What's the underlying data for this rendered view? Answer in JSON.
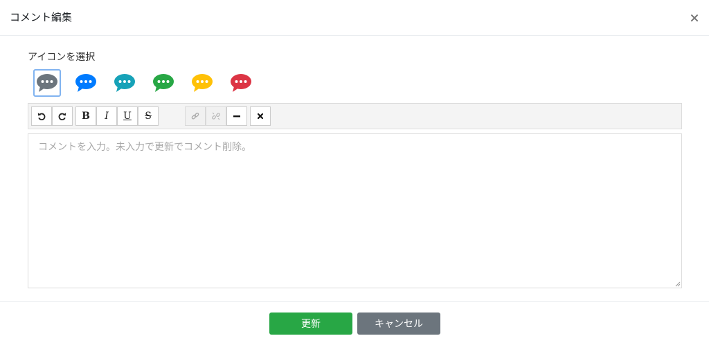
{
  "dialog": {
    "title": "コメント編集",
    "close_icon": "close-icon"
  },
  "icon_picker": {
    "label": "アイコンを選択",
    "selected_index": 0,
    "options": [
      {
        "name": "gray",
        "color": "#6c757d"
      },
      {
        "name": "blue",
        "color": "#007bff"
      },
      {
        "name": "teal",
        "color": "#17a2b8"
      },
      {
        "name": "green",
        "color": "#28a745"
      },
      {
        "name": "yellow",
        "color": "#ffc107"
      },
      {
        "name": "red",
        "color": "#dc3545"
      }
    ]
  },
  "toolbar": {
    "undo_icon": "undo-icon",
    "redo_icon": "redo-icon",
    "bold_label": "B",
    "italic_label": "I",
    "underline_label": "U",
    "strike_label": "S",
    "link_icon": "link-icon",
    "unlink_icon": "unlink-icon",
    "hr_icon": "horizontal-rule-icon",
    "clear_icon": "clear-format-icon"
  },
  "editor": {
    "value": "",
    "placeholder": "コメントを入力。未入力で更新でコメント削除。"
  },
  "footer": {
    "update_label": "更新",
    "cancel_label": "キャンセル"
  },
  "colors": {
    "update": "#28a745",
    "cancel": "#6c757d",
    "selected_border": "#80b3f0"
  }
}
